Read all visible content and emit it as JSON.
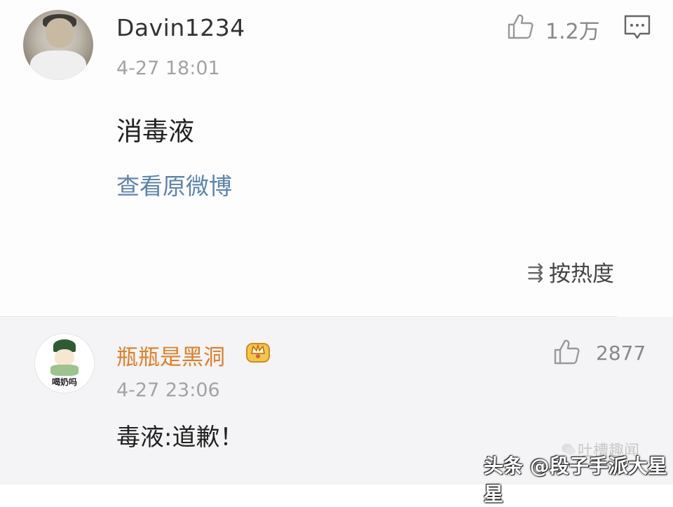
{
  "comment": {
    "username": "Davin1234",
    "timestamp": "4-27 18:01",
    "text": "消毒液",
    "view_link": "查看原微博",
    "like_count": "1.2万",
    "icons": {
      "like": "thumbs-up-icon",
      "comment": "comment-icon",
      "avatar": "user-avatar"
    }
  },
  "sort": {
    "icon": "sort-icon",
    "icon_glyph": "⇶",
    "label": "按热度"
  },
  "reply": {
    "username": "瓶瓶是黑洞",
    "username_color": "#e07f2a",
    "badge": "crown-badge-icon",
    "timestamp": "4-27 23:06",
    "text": "毒液:道歉！",
    "like_count": "2877",
    "avatar_text": "喝奶吗"
  },
  "watermark": {
    "source": "头条 @段子手派大星星",
    "background_text": "吐槽趣闻"
  }
}
